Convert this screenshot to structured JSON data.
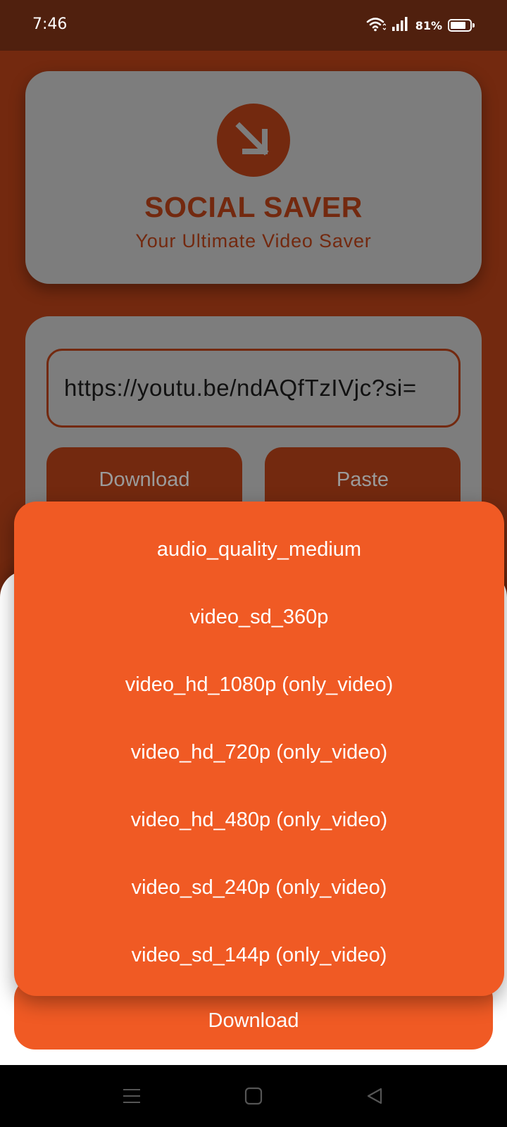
{
  "status_bar": {
    "time": "7:46",
    "battery_percent": "81%",
    "battery_level": 0.81,
    "icons": [
      "wifi-icon",
      "signal-icon",
      "battery-icon"
    ]
  },
  "header": {
    "logo_icon": "download-arrow-icon",
    "title": "SOCIAL SAVER",
    "subtitle": "Your Ultimate Video Saver"
  },
  "input": {
    "url_value": "https://youtu.be/ndAQfTzIVjc?si="
  },
  "buttons": {
    "download": "Download",
    "paste": "Paste"
  },
  "quality_menu": {
    "options": [
      "audio_quality_medium",
      "video_sd_360p",
      "video_hd_1080p (only_video)",
      "video_hd_720p (only_video)",
      "video_hd_480p (only_video)",
      "video_sd_240p (only_video)",
      "video_sd_144p (only_video)"
    ]
  },
  "sheet": {
    "download_label": "Download"
  },
  "nav_bar": {
    "icons": [
      "menu-icon",
      "home-icon",
      "back-icon"
    ]
  },
  "colors": {
    "status_bar": "#50200e",
    "brand_brown": "#73290f",
    "card_gray": "#7d7d7d",
    "accent_orange": "#f05a24"
  }
}
